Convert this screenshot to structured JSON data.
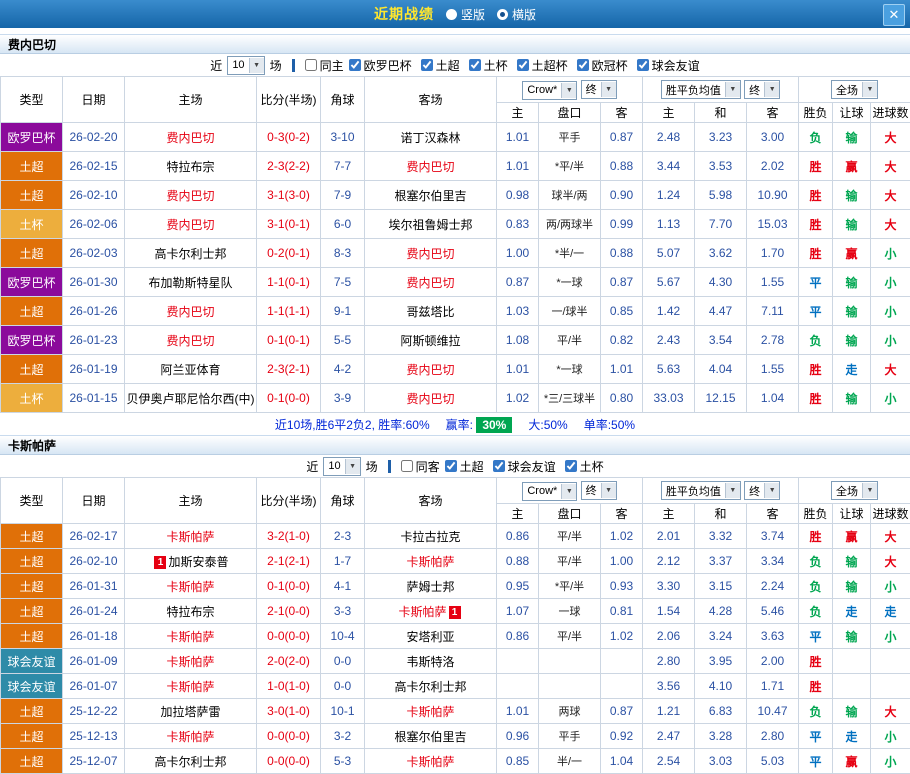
{
  "titlebar": {
    "title": "近期战绩",
    "radios": [
      {
        "label": "竖版",
        "selected": false
      },
      {
        "label": "横版",
        "selected": true
      }
    ],
    "close_icon": "✕"
  },
  "colors": {
    "win": "#e60012",
    "draw": "#0070c0",
    "lose": "#00a651",
    "chip_bg": "#00a651",
    "leagues": {
      "欧罗巴杯": "#8b0a9b",
      "土超": "#e07008",
      "土杯": "#edae3d",
      "球会友谊": "#2e8ba8"
    }
  },
  "table_header": {
    "cols": [
      "类型",
      "日期",
      "主场",
      "比分(半场)",
      "角球",
      "客场"
    ],
    "odds_select": "Crow*",
    "odds_final_select": "终",
    "europe_select": "胜平负均值",
    "europe_final_select": "终",
    "scope_select": "全场",
    "sub_cols": [
      "主",
      "盘口",
      "客",
      "主",
      "和",
      "客",
      "胜负",
      "让球",
      "进球数"
    ]
  },
  "sections": [
    {
      "team": "费内巴切",
      "filter": {
        "near": "近",
        "count": "10",
        "field": "场",
        "same": {
          "label": "同主",
          "checked": false
        },
        "leagues": [
          {
            "label": "欧罗巴杯",
            "checked": true
          },
          {
            "label": "土超",
            "checked": true
          },
          {
            "label": "土杯",
            "checked": true
          },
          {
            "label": "土超杯",
            "checked": true
          },
          {
            "label": "欧冠杯",
            "checked": true
          },
          {
            "label": "球会友谊",
            "checked": true
          }
        ]
      },
      "rows": [
        {
          "league": "欧罗巴杯",
          "date": "26-02-20",
          "home": "费内巴切",
          "home_hl": true,
          "score": "0-3(0-2)",
          "corner": "3-10",
          "away": "诺丁汉森林",
          "away_hl": false,
          "ah": [
            "1.01",
            "平手",
            "0.87"
          ],
          "eu": [
            "2.48",
            "3.23",
            "3.00"
          ],
          "res": [
            [
              "负",
              "lose"
            ],
            [
              "输",
              "lose"
            ],
            [
              "大",
              "win"
            ]
          ]
        },
        {
          "league": "土超",
          "date": "26-02-15",
          "home": "特拉布宗",
          "home_hl": false,
          "score": "2-3(2-2)",
          "corner": "7-7",
          "away": "费内巴切",
          "away_hl": true,
          "ah": [
            "1.01",
            "*平/半",
            "0.88"
          ],
          "eu": [
            "3.44",
            "3.53",
            "2.02"
          ],
          "res": [
            [
              "胜",
              "win"
            ],
            [
              "赢",
              "win"
            ],
            [
              "大",
              "win"
            ]
          ]
        },
        {
          "league": "土超",
          "date": "26-02-10",
          "home": "费内巴切",
          "home_hl": true,
          "score": "3-1(3-0)",
          "corner": "7-9",
          "away": "根塞尔伯里吉",
          "away_hl": false,
          "ah": [
            "0.98",
            "球半/两",
            "0.90"
          ],
          "eu": [
            "1.24",
            "5.98",
            "10.90"
          ],
          "res": [
            [
              "胜",
              "win"
            ],
            [
              "输",
              "lose"
            ],
            [
              "大",
              "win"
            ]
          ]
        },
        {
          "league": "土杯",
          "date": "26-02-06",
          "home": "费内巴切",
          "home_hl": true,
          "score": "3-1(0-1)",
          "corner": "6-0",
          "away": "埃尔祖鲁姆士邦",
          "away_hl": false,
          "ah": [
            "0.83",
            "两/两球半",
            "0.99"
          ],
          "eu": [
            "1.13",
            "7.70",
            "15.03"
          ],
          "res": [
            [
              "胜",
              "win"
            ],
            [
              "输",
              "lose"
            ],
            [
              "大",
              "win"
            ]
          ]
        },
        {
          "league": "土超",
          "date": "26-02-03",
          "home": "高卡尔利士邦",
          "home_hl": false,
          "score": "0-2(0-1)",
          "corner": "8-3",
          "away": "费内巴切",
          "away_hl": true,
          "ah": [
            "1.00",
            "*半/一",
            "0.88"
          ],
          "eu": [
            "5.07",
            "3.62",
            "1.70"
          ],
          "res": [
            [
              "胜",
              "win"
            ],
            [
              "赢",
              "win"
            ],
            [
              "小",
              "lose"
            ]
          ]
        },
        {
          "league": "欧罗巴杯",
          "date": "26-01-30",
          "home": "布加勒斯特星队",
          "home_hl": false,
          "score": "1-1(0-1)",
          "corner": "7-5",
          "away": "费内巴切",
          "away_hl": true,
          "ah": [
            "0.87",
            "*一球",
            "0.87"
          ],
          "eu": [
            "5.67",
            "4.30",
            "1.55"
          ],
          "res": [
            [
              "平",
              "draw"
            ],
            [
              "输",
              "lose"
            ],
            [
              "小",
              "lose"
            ]
          ]
        },
        {
          "league": "土超",
          "date": "26-01-26",
          "home": "费内巴切",
          "home_hl": true,
          "score": "1-1(1-1)",
          "corner": "9-1",
          "away": "哥兹塔比",
          "away_hl": false,
          "ah": [
            "1.03",
            "一/球半",
            "0.85"
          ],
          "eu": [
            "1.42",
            "4.47",
            "7.11"
          ],
          "res": [
            [
              "平",
              "draw"
            ],
            [
              "输",
              "lose"
            ],
            [
              "小",
              "lose"
            ]
          ]
        },
        {
          "league": "欧罗巴杯",
          "date": "26-01-23",
          "home": "费内巴切",
          "home_hl": true,
          "score": "0-1(0-1)",
          "corner": "5-5",
          "away": "阿斯顿维拉",
          "away_hl": false,
          "ah": [
            "1.08",
            "平/半",
            "0.82"
          ],
          "eu": [
            "2.43",
            "3.54",
            "2.78"
          ],
          "res": [
            [
              "负",
              "lose"
            ],
            [
              "输",
              "lose"
            ],
            [
              "小",
              "lose"
            ]
          ]
        },
        {
          "league": "土超",
          "date": "26-01-19",
          "home": "阿兰亚体育",
          "home_hl": false,
          "score": "2-3(2-1)",
          "corner": "4-2",
          "away": "费内巴切",
          "away_hl": true,
          "ah": [
            "1.01",
            "*一球",
            "1.01"
          ],
          "eu": [
            "5.63",
            "4.04",
            "1.55"
          ],
          "res": [
            [
              "胜",
              "win"
            ],
            [
              "走",
              "draw"
            ],
            [
              "大",
              "win"
            ]
          ]
        },
        {
          "league": "土杯",
          "date": "26-01-15",
          "home": "贝伊奥卢耶尼恰尔西(中)",
          "home_hl": false,
          "score": "0-1(0-0)",
          "corner": "3-9",
          "away": "费内巴切",
          "away_hl": true,
          "ah": [
            "1.02",
            "*三/三球半",
            "0.80"
          ],
          "eu": [
            "33.03",
            "12.15",
            "1.04"
          ],
          "res": [
            [
              "胜",
              "win"
            ],
            [
              "输",
              "lose"
            ],
            [
              "小",
              "lose"
            ]
          ]
        }
      ],
      "summary": {
        "text": "近10场,胜6平2负2, 胜率:60%",
        "win_rate_label": "赢率:",
        "win_rate_value": "30%",
        "big_label": "大:50%",
        "single_label": "单率:50%"
      }
    },
    {
      "team": "卡斯帕萨",
      "filter": {
        "near": "近",
        "count": "10",
        "field": "场",
        "same": {
          "label": "同客",
          "checked": false
        },
        "leagues": [
          {
            "label": "土超",
            "checked": true
          },
          {
            "label": "球会友谊",
            "checked": true
          },
          {
            "label": "土杯",
            "checked": true
          }
        ]
      },
      "rows": [
        {
          "league": "土超",
          "date": "26-02-17",
          "home": "卡斯帕萨",
          "home_hl": true,
          "score": "3-2(1-0)",
          "corner": "2-3",
          "away": "卡拉古拉克",
          "away_hl": false,
          "ah": [
            "0.86",
            "平/半",
            "1.02"
          ],
          "eu": [
            "2.01",
            "3.32",
            "3.74"
          ],
          "res": [
            [
              "胜",
              "win"
            ],
            [
              "赢",
              "win"
            ],
            [
              "大",
              "win"
            ]
          ]
        },
        {
          "league": "土超",
          "date": "26-02-10",
          "home": "加斯安泰普",
          "home_hl": false,
          "home_badge": "1",
          "home_badge_pos": "before",
          "score": "2-1(2-1)",
          "corner": "1-7",
          "away": "卡斯帕萨",
          "away_hl": true,
          "ah": [
            "0.88",
            "平/半",
            "1.00"
          ],
          "eu": [
            "2.12",
            "3.37",
            "3.34"
          ],
          "res": [
            [
              "负",
              "lose"
            ],
            [
              "输",
              "lose"
            ],
            [
              "大",
              "win"
            ]
          ]
        },
        {
          "league": "土超",
          "date": "26-01-31",
          "home": "卡斯帕萨",
          "home_hl": true,
          "score": "0-1(0-0)",
          "corner": "4-1",
          "away": "萨姆士邦",
          "away_hl": false,
          "ah": [
            "0.95",
            "*平/半",
            "0.93"
          ],
          "eu": [
            "3.30",
            "3.15",
            "2.24"
          ],
          "res": [
            [
              "负",
              "lose"
            ],
            [
              "输",
              "lose"
            ],
            [
              "小",
              "lose"
            ]
          ]
        },
        {
          "league": "土超",
          "date": "26-01-24",
          "home": "特拉布宗",
          "home_hl": false,
          "score": "2-1(0-0)",
          "corner": "3-3",
          "away": "卡斯帕萨",
          "away_hl": true,
          "away_badge": "1",
          "away_badge_pos": "after",
          "ah": [
            "1.07",
            "一球",
            "0.81"
          ],
          "eu": [
            "1.54",
            "4.28",
            "5.46"
          ],
          "res": [
            [
              "负",
              "lose"
            ],
            [
              "走",
              "draw"
            ],
            [
              "走",
              "draw"
            ]
          ]
        },
        {
          "league": "土超",
          "date": "26-01-18",
          "home": "卡斯帕萨",
          "home_hl": true,
          "score": "0-0(0-0)",
          "corner": "10-4",
          "away": "安塔利亚",
          "away_hl": false,
          "ah": [
            "0.86",
            "平/半",
            "1.02"
          ],
          "eu": [
            "2.06",
            "3.24",
            "3.63"
          ],
          "res": [
            [
              "平",
              "draw"
            ],
            [
              "输",
              "lose"
            ],
            [
              "小",
              "lose"
            ]
          ]
        },
        {
          "league": "球会友谊",
          "date": "26-01-09",
          "home": "卡斯帕萨",
          "home_hl": true,
          "score": "2-0(2-0)",
          "corner": "0-0",
          "away": "韦斯特洛",
          "away_hl": false,
          "ah": [
            "",
            "",
            ""
          ],
          "eu": [
            "2.80",
            "3.95",
            "2.00"
          ],
          "res": [
            [
              "胜",
              "win"
            ],
            [
              "",
              ""
            ],
            [
              "",
              ""
            ]
          ]
        },
        {
          "league": "球会友谊",
          "date": "26-01-07",
          "home": "卡斯帕萨",
          "home_hl": true,
          "score": "1-0(1-0)",
          "corner": "0-0",
          "away": "高卡尔利士邦",
          "away_hl": false,
          "ah": [
            "",
            "",
            ""
          ],
          "eu": [
            "3.56",
            "4.10",
            "1.71"
          ],
          "res": [
            [
              "胜",
              "win"
            ],
            [
              "",
              ""
            ],
            [
              "",
              ""
            ]
          ]
        },
        {
          "league": "土超",
          "date": "25-12-22",
          "home": "加拉塔萨雷",
          "home_hl": false,
          "score": "3-0(1-0)",
          "corner": "10-1",
          "away": "卡斯帕萨",
          "away_hl": true,
          "ah": [
            "1.01",
            "两球",
            "0.87"
          ],
          "eu": [
            "1.21",
            "6.83",
            "10.47"
          ],
          "res": [
            [
              "负",
              "lose"
            ],
            [
              "输",
              "lose"
            ],
            [
              "大",
              "win"
            ]
          ]
        },
        {
          "league": "土超",
          "date": "25-12-13",
          "home": "卡斯帕萨",
          "home_hl": true,
          "score": "0-0(0-0)",
          "corner": "3-2",
          "away": "根塞尔伯里吉",
          "away_hl": false,
          "ah": [
            "0.96",
            "平手",
            "0.92"
          ],
          "eu": [
            "2.47",
            "3.28",
            "2.80"
          ],
          "res": [
            [
              "平",
              "draw"
            ],
            [
              "走",
              "draw"
            ],
            [
              "小",
              "lose"
            ]
          ]
        },
        {
          "league": "土超",
          "date": "25-12-07",
          "home": "高卡尔利士邦",
          "home_hl": false,
          "score": "0-0(0-0)",
          "corner": "5-3",
          "away": "卡斯帕萨",
          "away_hl": true,
          "ah": [
            "0.85",
            "半/一",
            "1.04"
          ],
          "eu": [
            "2.54",
            "3.03",
            "5.03"
          ],
          "res": [
            [
              "平",
              "draw"
            ],
            [
              "赢",
              "win"
            ],
            [
              "小",
              "lose"
            ]
          ]
        }
      ]
    }
  ]
}
